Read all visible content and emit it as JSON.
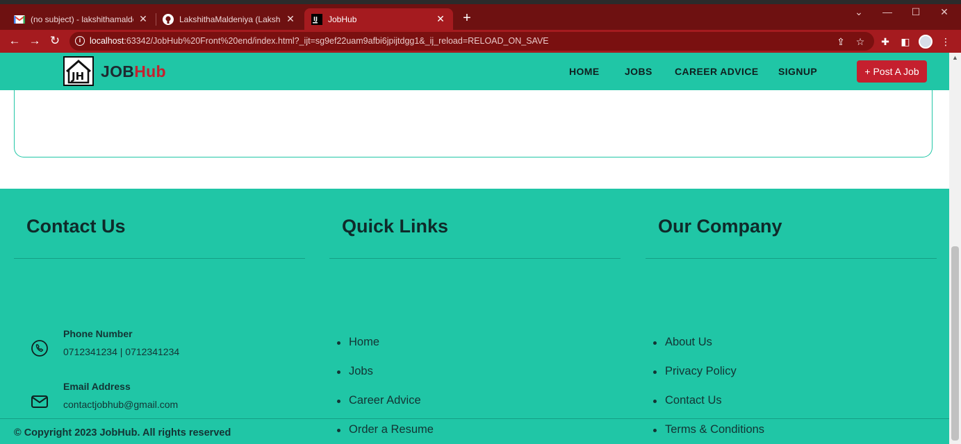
{
  "browser": {
    "tabs": [
      {
        "title": "(no subject) - lakshithamaldeniya",
        "icon": "gmail-icon"
      },
      {
        "title": "LakshithaMaldeniya (Lakshitha M",
        "icon": "github-icon"
      },
      {
        "title": "JobHub",
        "icon": "intellij-icon"
      }
    ],
    "url_host": "localhost",
    "url_rest": ":63342/JobHub%20Front%20end/index.html?_ijt=sg9ef22uam9afbi6jpijtdgg1&_ij_reload=RELOAD_ON_SAVE"
  },
  "navbar": {
    "logo_primary": "JOB",
    "logo_accent": "Hub",
    "logo_mark": "JH",
    "links": [
      "HOME",
      "JOBS",
      "CAREER ADVICE",
      "SIGNUP"
    ],
    "cta": "+ Post A Job"
  },
  "footer": {
    "contact": {
      "title": "Contact Us",
      "phone_label": "Phone Number",
      "phone_value": "0712341234 | 0712341234",
      "email_label": "Email Address",
      "email_value": "contactjobhub@gmail.com"
    },
    "quick_links": {
      "title": "Quick Links",
      "items": [
        "Home",
        "Jobs",
        "Career Advice",
        "Order a Resume"
      ]
    },
    "company": {
      "title": "Our Company",
      "items": [
        "About Us",
        "Privacy Policy",
        "Contact Us",
        "Terms & Conditions"
      ]
    },
    "copyright": "© Copyright 2023 JobHub. All rights reserved"
  },
  "colors": {
    "brand_teal": "#20c6a6",
    "brand_red": "#c5202e",
    "browser_frame": "#a51b1f"
  }
}
